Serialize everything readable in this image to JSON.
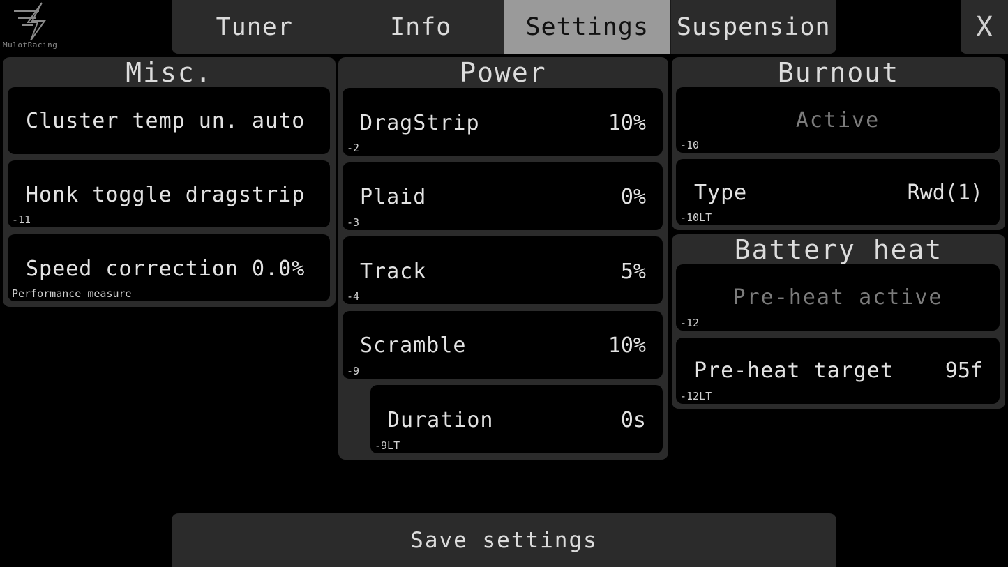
{
  "brand": {
    "name": "MulotRacing",
    "logo_icon": "lightning-logo-icon"
  },
  "tabs": [
    {
      "label": "Tuner",
      "active": false
    },
    {
      "label": "Info",
      "active": false
    },
    {
      "label": "Settings",
      "active": true
    },
    {
      "label": "Suspension",
      "active": false
    }
  ],
  "close_label": "X",
  "misc": {
    "title": "Misc.",
    "items": [
      {
        "label": "Cluster temp un. auto",
        "sub": ""
      },
      {
        "label": "Honk toggle dragstrip",
        "sub": "-11"
      },
      {
        "label": "Speed correction 0.0%",
        "sub": "Performance measure"
      }
    ]
  },
  "power": {
    "title": "Power",
    "items": [
      {
        "label": "DragStrip",
        "value": "10%",
        "sub": "-2"
      },
      {
        "label": "Plaid",
        "value": "0%",
        "sub": "-3"
      },
      {
        "label": "Track",
        "value": "5%",
        "sub": "-4"
      },
      {
        "label": "Scramble",
        "value": "10%",
        "sub": "-9"
      },
      {
        "label": "Duration",
        "value": "0s",
        "sub": "-9LT"
      }
    ]
  },
  "burnout": {
    "title": "Burnout",
    "active_label": "Active",
    "active_sub": "-10",
    "type_label": "Type",
    "type_value": "Rwd(1)",
    "type_sub": "-10LT"
  },
  "battery_heat": {
    "title": "Battery heat",
    "preheat_label": "Pre-heat active",
    "preheat_sub": "-12",
    "target_label": "Pre-heat target",
    "target_value": "95f",
    "target_sub": "-12LT"
  },
  "save_label": "Save settings",
  "colors": {
    "panel": "#2b2b2b",
    "active_tab": "#9a9a9a",
    "card": "#000000",
    "text": "#e2e2e2",
    "dim_text": "#7c7c7c"
  }
}
